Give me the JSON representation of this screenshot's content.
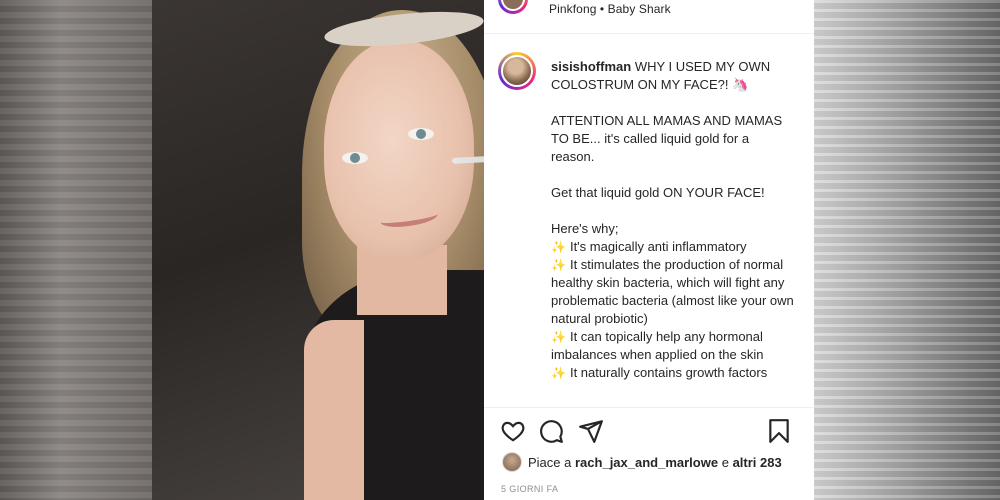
{
  "post": {
    "music_line": "Pinkfong • Baby Shark",
    "username": "sisishoffman",
    "caption_lines": [
      "WHY I USED MY OWN COLOSTRUM ON MY FACE?! 🦄",
      "",
      "ATTENTION ALL MAMAS AND MAMAS TO BE... it's called liquid gold for a reason.",
      "",
      "Get that liquid gold ON YOUR FACE!",
      "",
      "Here's why;"
    ],
    "bullets": [
      "It's magically anti inflammatory",
      "It stimulates the production of normal healthy skin bacteria, which will fight any problematic bacteria (almost like your own natural probiotic)",
      "It can topically help any hormonal imbalances when applied on the skin",
      "It naturally contains growth factors"
    ],
    "bullet_icon": "sparkles-emoji",
    "likes": {
      "prefix": "Piace a",
      "user": "rach_jax_and_marlowe",
      "conjunction": "e",
      "others": "altri 283"
    },
    "date": "5 GIORNI FA"
  },
  "icons": {
    "like": "heart-icon",
    "comment": "comment-icon",
    "share": "share-icon",
    "save": "bookmark-icon"
  },
  "colors": {
    "panel_bg": "#ffffff",
    "text": "#262626",
    "muted": "#8e8e8e",
    "sparkle": "#e0b300"
  }
}
